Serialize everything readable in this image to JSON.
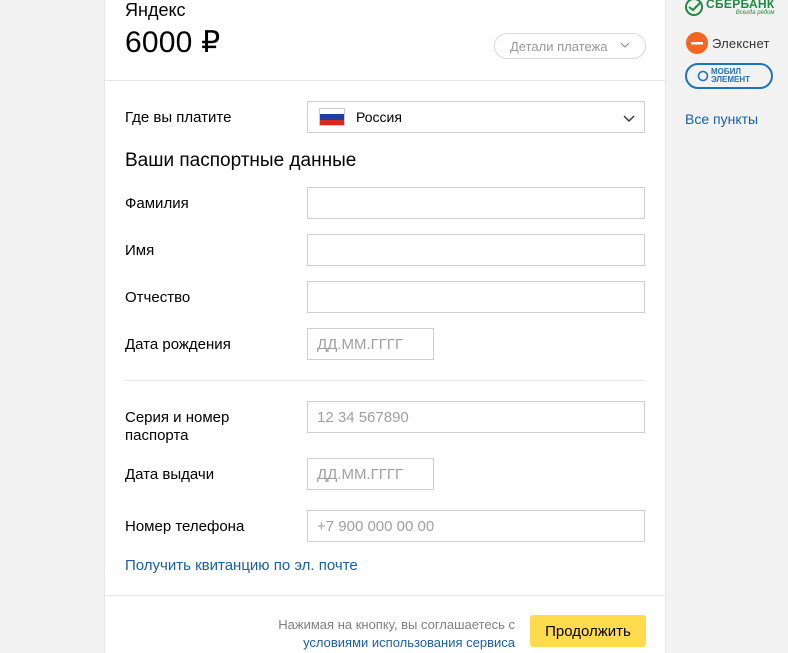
{
  "payment": {
    "merchant": "Яндекс",
    "amount": "6000 ₽",
    "details_label": "Детали платежа"
  },
  "country": {
    "label": "Где вы платите",
    "value": "Россия"
  },
  "passport": {
    "section_title": "Ваши паспортные данные",
    "surname_label": "Фамилия",
    "surname_value": "",
    "name_label": "Имя",
    "name_value": "",
    "patronymic_label": "Отчество",
    "patronymic_value": "",
    "birthdate_label": "Дата рождения",
    "birthdate_placeholder": "ДД.ММ.ГГГГ",
    "passport_number_label_line1": "Серия и номер",
    "passport_number_label_line2": "паспорта",
    "passport_number_placeholder": "12 34 567890",
    "issue_date_label": "Дата выдачи",
    "issue_date_placeholder": "ДД.ММ.ГГГГ",
    "phone_label": "Номер телефона",
    "phone_placeholder": "+7 900 000 00 00"
  },
  "receipt_link": "Получить квитанцию по эл. почте",
  "footer": {
    "agree_text": "Нажимая на кнопку, вы соглашаетесь с",
    "terms_link": "условиями использования сервиса",
    "continue_label": "Продолжить"
  },
  "sidebar": {
    "sber_name": "СБЕРБАНК",
    "sber_tagline": "Всегда рядом",
    "elexnet_name": "Элекснет",
    "mobil_line1": "МОБИЛ",
    "mobil_line2": "ЭЛЕМЕНТ",
    "all_points": "Все пункты"
  },
  "colors": {
    "accent_button": "#ffdb4d",
    "link": "#1a5ea8",
    "sber_green": "#1e8b3f",
    "elexnet_orange": "#f26522",
    "mobil_blue": "#1e73be"
  }
}
